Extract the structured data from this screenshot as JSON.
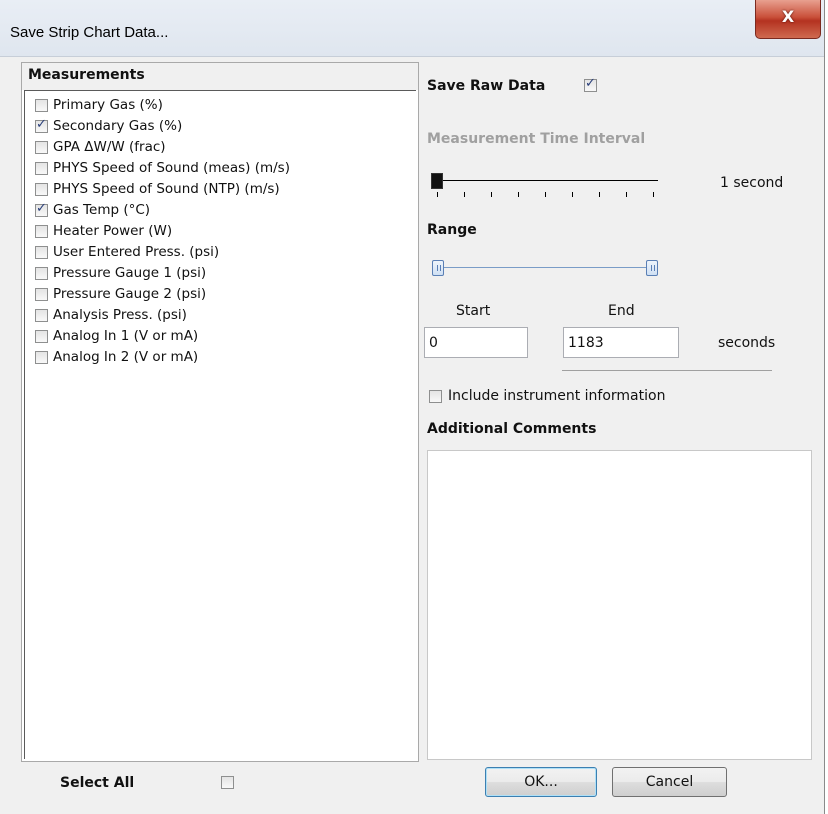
{
  "window": {
    "title": "Save Strip Chart Data...",
    "close_symbol": "X"
  },
  "measurements": {
    "header": "Measurements",
    "items": [
      {
        "label": "Primary Gas (%)",
        "checked": false
      },
      {
        "label": "Secondary Gas (%)",
        "checked": true
      },
      {
        "label": "GPA ΔW/W (frac)",
        "checked": false
      },
      {
        "label": "PHYS Speed of Sound (meas) (m/s)",
        "checked": false
      },
      {
        "label": "PHYS Speed of Sound (NTP) (m/s)",
        "checked": false
      },
      {
        "label": "Gas Temp (°C)",
        "checked": true
      },
      {
        "label": "Heater Power (W)",
        "checked": false
      },
      {
        "label": "User Entered Press. (psi)",
        "checked": false
      },
      {
        "label": "Pressure Gauge 1 (psi)",
        "checked": false
      },
      {
        "label": "Pressure Gauge 2 (psi)",
        "checked": false
      },
      {
        "label": "Analysis Press. (psi)",
        "checked": false
      },
      {
        "label": "Analog In 1 (V or mA)",
        "checked": false
      },
      {
        "label": "Analog In 2 (V or mA)",
        "checked": false
      }
    ],
    "select_all_label": "Select All",
    "select_all_checked": false
  },
  "raw_data": {
    "label": "Save Raw Data",
    "checked": true
  },
  "interval": {
    "label": "Measurement Time Interval",
    "value_text": "1 second",
    "slider_position": 0
  },
  "range": {
    "label": "Range",
    "start_label": "Start",
    "end_label": "End",
    "start_value": "0",
    "end_value": "1183",
    "unit": "seconds"
  },
  "instrument_info": {
    "label": "Include instrument information",
    "checked": false
  },
  "comments": {
    "label": "Additional Comments",
    "value": ""
  },
  "buttons": {
    "ok": "OK...",
    "cancel": "Cancel"
  }
}
